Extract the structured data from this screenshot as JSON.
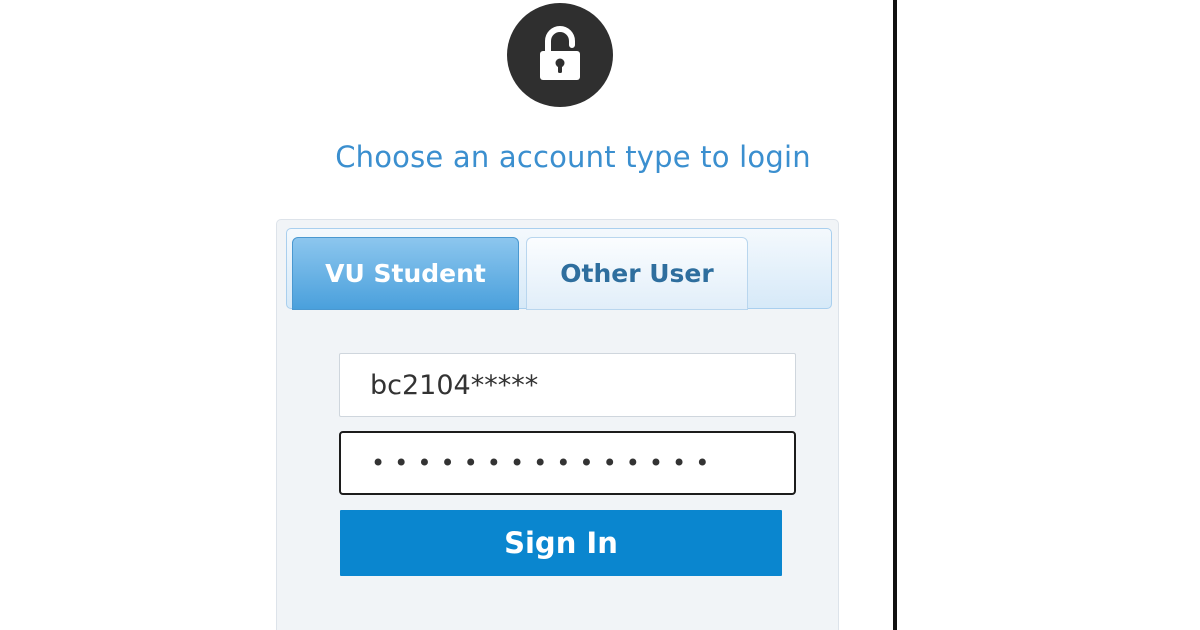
{
  "header": {
    "icon": "lock-icon",
    "prompt": "Choose an account type to login"
  },
  "tabs": [
    {
      "label": "VU Student",
      "active": true
    },
    {
      "label": "Other User",
      "active": false
    }
  ],
  "form": {
    "username_value": "bc2104*****",
    "password_value": "•••••••••••••••",
    "signin_label": "Sign In"
  },
  "colors": {
    "accent": "#0a86cf",
    "prompt_text": "#3b8fcf",
    "lock_badge": "#2f2f2f"
  }
}
